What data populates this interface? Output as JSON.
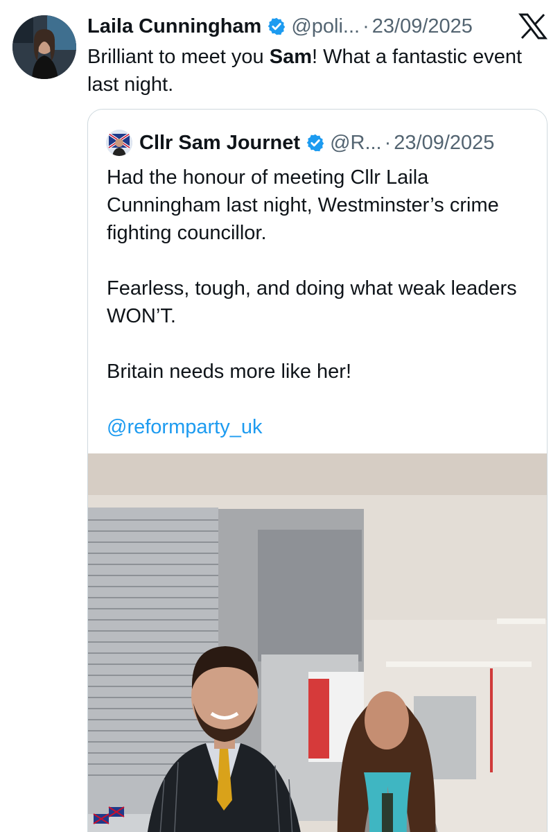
{
  "post": {
    "author_name": "Laila Cunningham",
    "handle": "@poli...",
    "separator": "·",
    "date": "23/09/2025",
    "text_before": "Brilliant to meet you ",
    "text_bold": "Sam",
    "text_after": "! What a fantastic event last night.",
    "platform_icon": "x-logo-icon",
    "verified_icon": "verified-badge-icon"
  },
  "quoted_post": {
    "author_name": "Cllr Sam Journet",
    "handle": "@R...",
    "separator": "·",
    "date": "23/09/2025",
    "paragraph_1": "Had the honour of meeting Cllr Laila Cunningham last night, Westminster’s crime fighting councillor.",
    "paragraph_2": "Fearless, tough, and doing what weak leaders WON’T.",
    "paragraph_3": "Britain needs more like her!",
    "mention": "@reformparty_uk"
  },
  "colors": {
    "link": "#1d9bf0",
    "verified": "#1d9bf0",
    "muted_text": "#536471",
    "border": "#cfd9de"
  }
}
